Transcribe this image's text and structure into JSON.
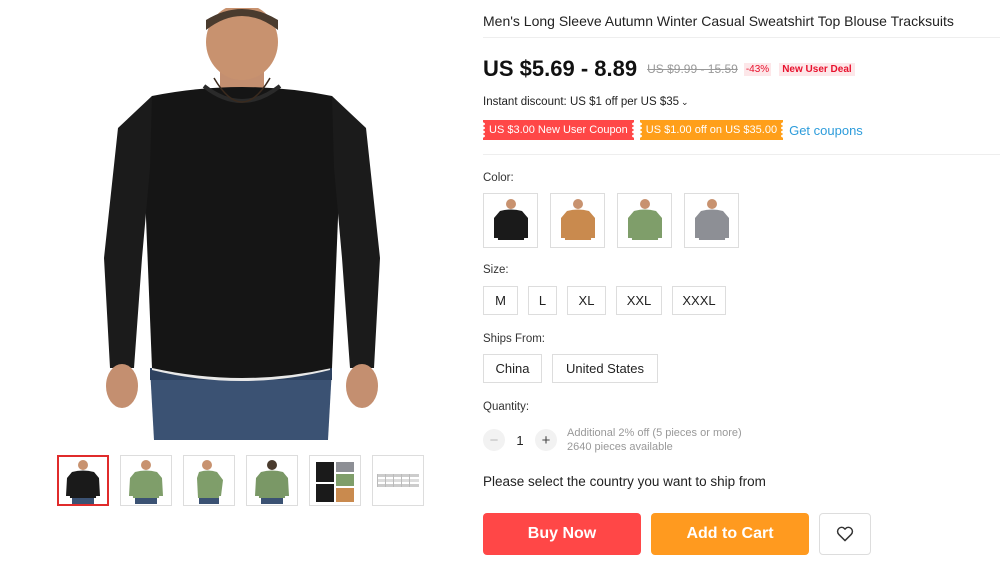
{
  "product": {
    "title": "Men's Long Sleeve Autumn Winter Casual Sweatshirt Top Blouse Tracksuits"
  },
  "price": {
    "current": "US $5.69 - 8.89",
    "original": "US $9.99 - 15.59",
    "discount": "-43%",
    "deal_badge": "New User Deal"
  },
  "instant_discount": "Instant discount: US $1 off per US $35",
  "coupons": {
    "items": [
      "US $3.00 New User Coupon",
      "US $1.00 off on US $35.00"
    ],
    "link": "Get coupons"
  },
  "color": {
    "label": "Color:",
    "swatches": [
      {
        "name": "black",
        "hex": "#1a1a1a"
      },
      {
        "name": "khaki",
        "hex": "#c98a4e"
      },
      {
        "name": "green",
        "hex": "#7f9e6a"
      },
      {
        "name": "gray",
        "hex": "#8d8f95"
      }
    ]
  },
  "size": {
    "label": "Size:",
    "options": [
      "M",
      "L",
      "XL",
      "XXL",
      "XXXL"
    ]
  },
  "ships_from": {
    "label": "Ships From:",
    "options": [
      "China",
      "United States"
    ]
  },
  "quantity": {
    "label": "Quantity:",
    "value": "1",
    "bulk_info": "Additional 2% off (5 pieces or more)",
    "available": "2640 pieces available"
  },
  "ship_message": "Please select the country you want to ship from",
  "actions": {
    "buy_now": "Buy Now",
    "add_to_cart": "Add to Cart"
  },
  "thumbnails": [
    {
      "name": "black-shirt",
      "hex": "#1a1a1a",
      "active": true
    },
    {
      "name": "green-shirt-front",
      "hex": "#7f9e6a",
      "active": false
    },
    {
      "name": "green-shirt-side",
      "hex": "#7f9e6a",
      "active": false
    },
    {
      "name": "green-shirt-back",
      "hex": "#7f9e6a",
      "active": false
    },
    {
      "name": "color-collage",
      "hex": "#333333",
      "active": false
    },
    {
      "name": "size-chart",
      "hex": "#cccccc",
      "active": false
    }
  ],
  "colors": {
    "price_red": "#ff4747",
    "cart_orange": "#ff9a1f",
    "link_blue": "#2d9cdb"
  }
}
